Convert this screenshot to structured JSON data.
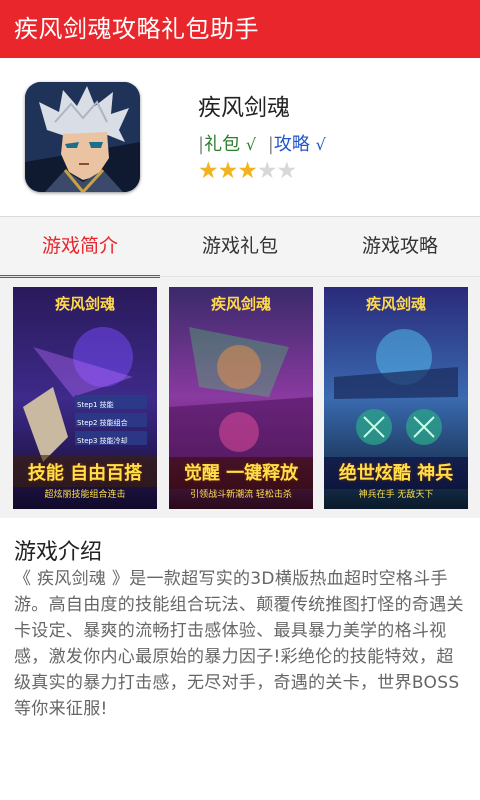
{
  "header": {
    "title": "疾风剑魂攻略礼包助手"
  },
  "app": {
    "name": "疾风剑魂",
    "icon": "anime-hero-icon",
    "tags": [
      {
        "label": "礼包",
        "check": "√"
      },
      {
        "label": "攻略",
        "check": "√"
      }
    ],
    "rating": {
      "value": 3,
      "max": 5,
      "filled": "★★★",
      "empty": "★★"
    }
  },
  "tabs": [
    {
      "label": "游戏简介",
      "active": true
    },
    {
      "label": "游戏礼包",
      "active": false
    },
    {
      "label": "游戏攻略",
      "active": false
    }
  ],
  "screenshots": [
    {
      "logo": "疾风剑魂",
      "banner": "技能 自由百搭",
      "subtitle": "超炫丽技能组合连击",
      "steps": [
        "Step1 技能",
        "Step2 技能组合",
        "Step3 技能冷却"
      ]
    },
    {
      "logo": "疾风剑魂",
      "banner": "觉醒 一键释放",
      "subtitle": "引领战斗新潮流 轻松击杀",
      "steps": []
    },
    {
      "logo": "疾风剑魂",
      "banner": "绝世炫酷 神兵",
      "subtitle": "神兵在手 无敌天下",
      "steps": []
    }
  ],
  "description": {
    "title": "游戏介绍",
    "body": "《 疾风剑魂 》是一款超写实的3D横版热血超时空格斗手游。高自由度的技能组合玩法、颠覆传统推图打怪的奇遇关卡设定、暴爽的流畅打击感体验、最具暴力美学的格斗视感，激发你内心最原始的暴力因子!彩绝伦的技能特效，超级真实的暴力打击感，无尽对手，奇遇的关卡，世界BOSS等你来征服!"
  },
  "colors": {
    "accent": "#e8262b",
    "star": "#f2b320",
    "gift_tag": "#2d7d2d",
    "guide_tag": "#2255cc"
  }
}
